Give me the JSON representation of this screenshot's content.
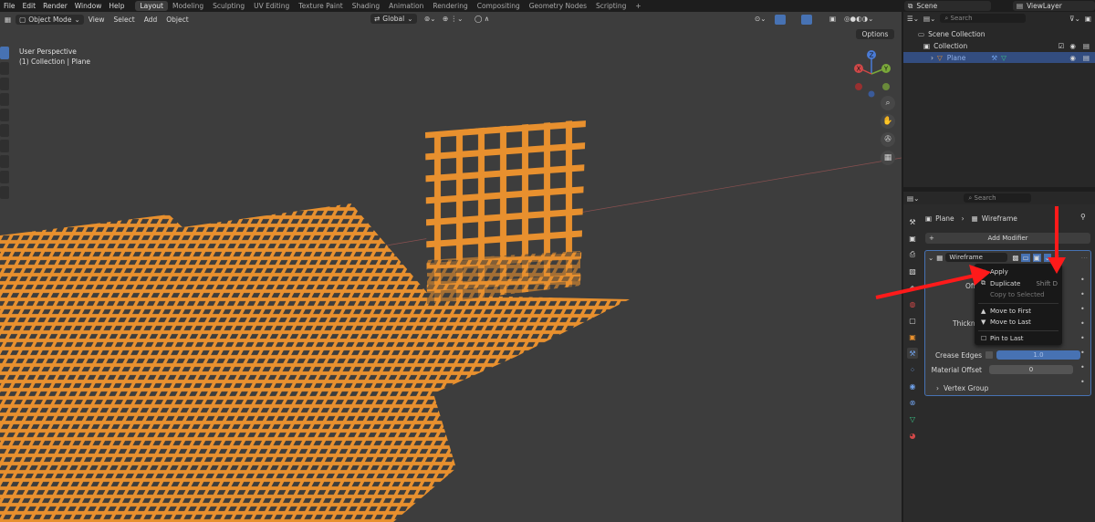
{
  "menu": [
    "File",
    "Edit",
    "Render",
    "Window",
    "Help"
  ],
  "workspaces": [
    "Layout",
    "Modeling",
    "Sculpting",
    "UV Editing",
    "Texture Paint",
    "Shading",
    "Animation",
    "Rendering",
    "Compositing",
    "Geometry Nodes",
    "Scripting"
  ],
  "add_workspace": "+",
  "scene": "Scene",
  "view_layer": "ViewLayer",
  "viewport": {
    "mode": "Object Mode",
    "menus": [
      "View",
      "Select",
      "Add",
      "Object"
    ],
    "orientation": "Global",
    "options_label": "Options",
    "perspective": "User Perspective",
    "collection_info": "(1) Collection | Plane",
    "gizmo_axes": [
      "Z",
      "Y",
      "X"
    ]
  },
  "outliner": {
    "search_placeholder": "Search",
    "scene_collection": "Scene Collection",
    "collection": "Collection",
    "object": "Plane"
  },
  "properties": {
    "search_placeholder": "Search",
    "breadcrumb_object": "Plane",
    "breadcrumb_modifier": "Wireframe",
    "add_modifier": "Add Modifier",
    "modifier_name": "Wireframe",
    "partial_label_offset": "Off",
    "partial_label_thickness": "Thickn",
    "crease_edges_label": "Crease Edges",
    "crease_edges_value": "1.0",
    "material_offset_label": "Material Offset",
    "material_offset_value": "0",
    "vertex_group": "Vertex Group"
  },
  "context_menu": {
    "apply": "Apply",
    "duplicate": "Duplicate",
    "duplicate_shortcut": "Shift D",
    "copy_to_selected": "Copy to Selected",
    "move_to_first": "Move to First",
    "move_to_last": "Move to Last",
    "pin_to_last": "Pin to Last"
  },
  "colors": {
    "accent_blue": "#4772b3",
    "wire_orange": "#e8902e",
    "arrow_red": "#ff1a1a"
  }
}
